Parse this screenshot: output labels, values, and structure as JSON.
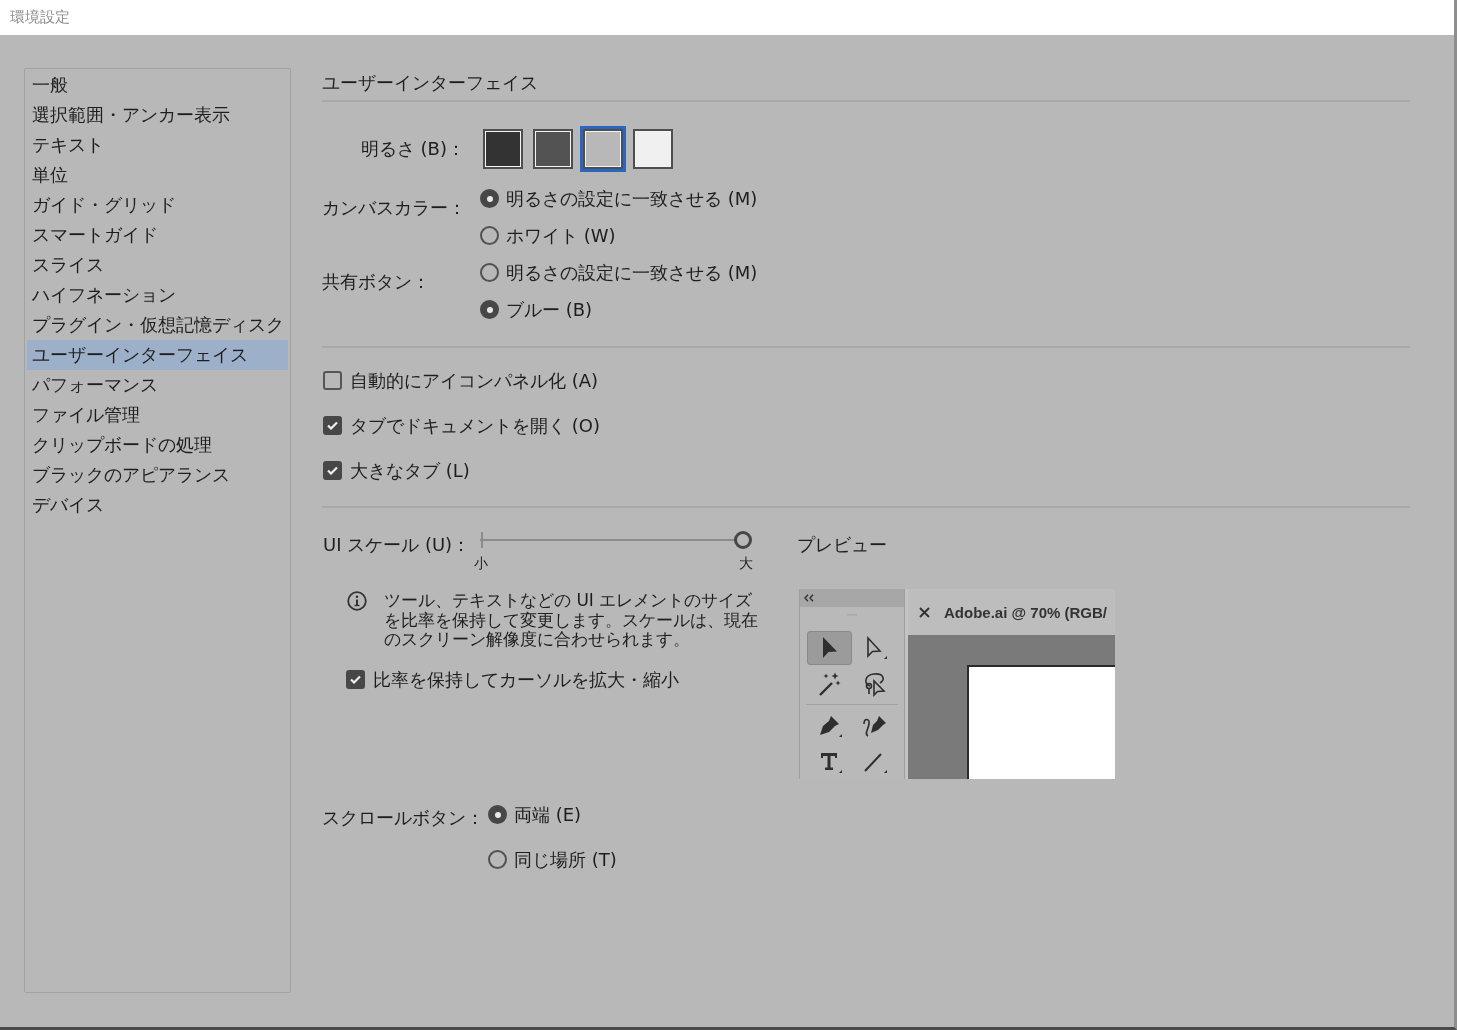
{
  "window": {
    "title": "環境設定"
  },
  "sidebar": {
    "items": [
      {
        "label": "一般",
        "selected": false
      },
      {
        "label": "選択範囲・アンカー表示",
        "selected": false
      },
      {
        "label": "テキスト",
        "selected": false
      },
      {
        "label": "単位",
        "selected": false
      },
      {
        "label": "ガイド・グリッド",
        "selected": false
      },
      {
        "label": "スマートガイド",
        "selected": false
      },
      {
        "label": "スライス",
        "selected": false
      },
      {
        "label": "ハイフネーション",
        "selected": false
      },
      {
        "label": "プラグイン・仮想記憶ディスク",
        "selected": false
      },
      {
        "label": "ユーザーインターフェイス",
        "selected": true
      },
      {
        "label": "パフォーマンス",
        "selected": false
      },
      {
        "label": "ファイル管理",
        "selected": false
      },
      {
        "label": "クリップボードの処理",
        "selected": false
      },
      {
        "label": "ブラックのアピアランス",
        "selected": false
      },
      {
        "label": "デバイス",
        "selected": false
      }
    ]
  },
  "section": {
    "title": "ユーザーインターフェイス"
  },
  "brightness": {
    "label": "明るさ (B)：",
    "swatches": [
      {
        "color": "#333333",
        "selected": false
      },
      {
        "color": "#535353",
        "selected": false
      },
      {
        "color": "#b8b8b8",
        "selected": true
      },
      {
        "color": "#f0f0f0",
        "selected": false
      }
    ]
  },
  "canvas_color": {
    "label": "カンバスカラー：",
    "options": [
      {
        "label": "明るさの設定に一致させる (M)",
        "selected": true
      },
      {
        "label": "ホワイト (W)",
        "selected": false
      }
    ]
  },
  "share_button": {
    "label": "共有ボタン：",
    "options": [
      {
        "label": "明るさの設定に一致させる (M)",
        "selected": false
      },
      {
        "label": "ブルー (B)",
        "selected": true
      }
    ]
  },
  "checkboxes": [
    {
      "label": "自動的にアイコンパネル化 (A)",
      "checked": false
    },
    {
      "label": "タブでドキュメントを開く (O)",
      "checked": true
    },
    {
      "label": "大きなタブ (L)",
      "checked": true
    }
  ],
  "ui_scale": {
    "label": "UI スケール (U)：",
    "level": 1,
    "min_label": "小",
    "max_label": "大",
    "info": "ツール、テキストなどの UI エレメントのサイズを比率を保持して変更します。スケールは、現在のスクリーン解像度に合わせられます。",
    "cursor_option": {
      "label": "比率を保持してカーソルを拡大・縮小",
      "checked": true
    }
  },
  "preview": {
    "label": "プレビュー",
    "document_tab": "Adobe.ai @ 70% (RGB/",
    "tool_groups": [
      [
        {
          "kind": "selection",
          "selected": true
        },
        {
          "kind": "direct_selection",
          "selected": false
        },
        {
          "kind": "magic_wand",
          "selected": false
        },
        {
          "kind": "lasso",
          "selected": false
        }
      ],
      [
        {
          "kind": "pen",
          "selected": false
        },
        {
          "kind": "curvature",
          "selected": false
        },
        {
          "kind": "type",
          "selected": false
        },
        {
          "kind": "line",
          "selected": false
        }
      ]
    ]
  },
  "scroll_buttons": {
    "label": "スクロールボタン：",
    "options": [
      {
        "label": "両端 (E)",
        "selected": true
      },
      {
        "label": "同じ場所 (T)",
        "selected": false
      }
    ]
  }
}
